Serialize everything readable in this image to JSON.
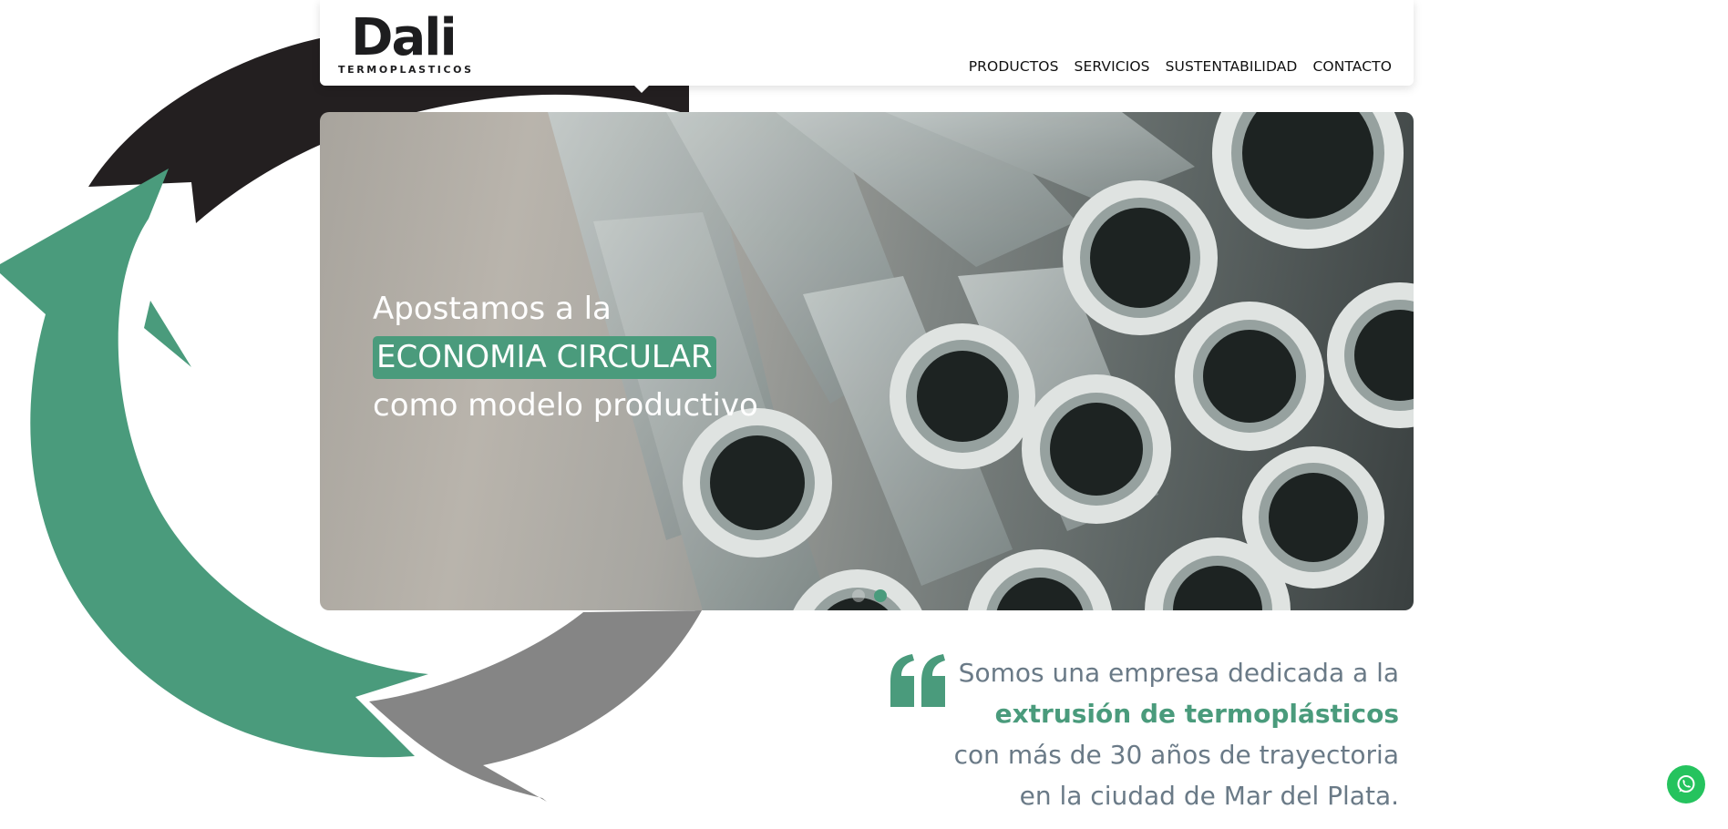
{
  "brand": {
    "name": "Dali",
    "subtitle": "TERMOPLASTICOS",
    "accent_color": "#4a9b7c"
  },
  "nav": {
    "items": [
      "PRODUCTOS",
      "SERVICIOS",
      "SUSTENTABILIDAD",
      "CONTACTO"
    ]
  },
  "hero": {
    "line1": "Apostamos a la",
    "highlight": "ECONOMIA CIRCULAR",
    "line3": "como modelo productivo",
    "slides": 2,
    "active_slide": 2
  },
  "intro": {
    "text_before": "Somos una empresa dedicada a la ",
    "emphasis": "extrusión de termoplásticos",
    "text_after": " con más de 30 años de trayectoria en la ciudad de Mar del Plata."
  },
  "icons": {
    "quote": "quote-icon",
    "whatsapp": "whatsapp-icon",
    "recycle": "recycle-arrows-graphic"
  }
}
